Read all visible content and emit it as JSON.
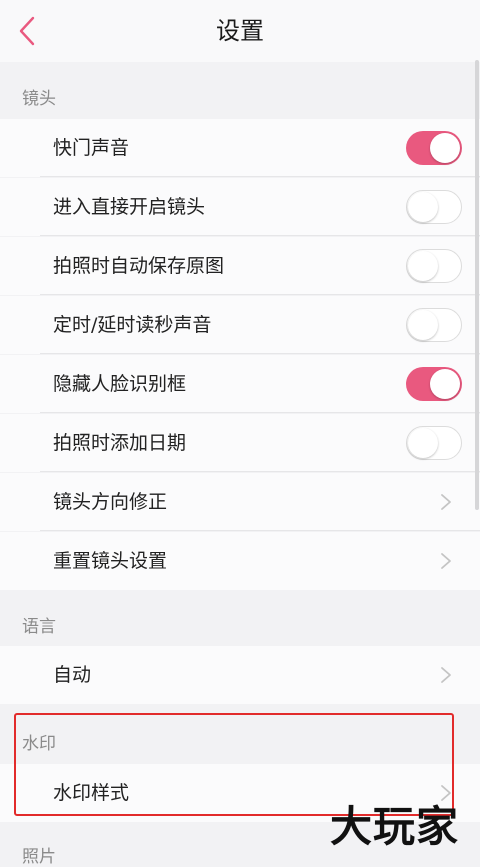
{
  "header": {
    "title": "设置",
    "back_icon": "chevron-left-icon"
  },
  "colors": {
    "accent": "#e9597f",
    "highlight_box": "#e22b2b"
  },
  "sections": {
    "lens": {
      "label": "镜头",
      "items": [
        {
          "label": "快门声音",
          "type": "toggle",
          "on": true
        },
        {
          "label": "进入直接开启镜头",
          "type": "toggle",
          "on": false
        },
        {
          "label": "拍照时自动保存原图",
          "type": "toggle",
          "on": false
        },
        {
          "label": "定时/延时读秒声音",
          "type": "toggle",
          "on": false
        },
        {
          "label": "隐藏人脸识别框",
          "type": "toggle",
          "on": true
        },
        {
          "label": "拍照时添加日期",
          "type": "toggle",
          "on": false
        },
        {
          "label": "镜头方向修正",
          "type": "link"
        },
        {
          "label": "重置镜头设置",
          "type": "link"
        }
      ]
    },
    "language": {
      "label": "语言",
      "items": [
        {
          "label": "自动",
          "type": "link"
        }
      ]
    },
    "watermark": {
      "label": "水印",
      "items": [
        {
          "label": "水印样式",
          "type": "link"
        }
      ]
    },
    "photo": {
      "label": "照片"
    }
  },
  "overlay": {
    "logo_text": "大玩家"
  }
}
